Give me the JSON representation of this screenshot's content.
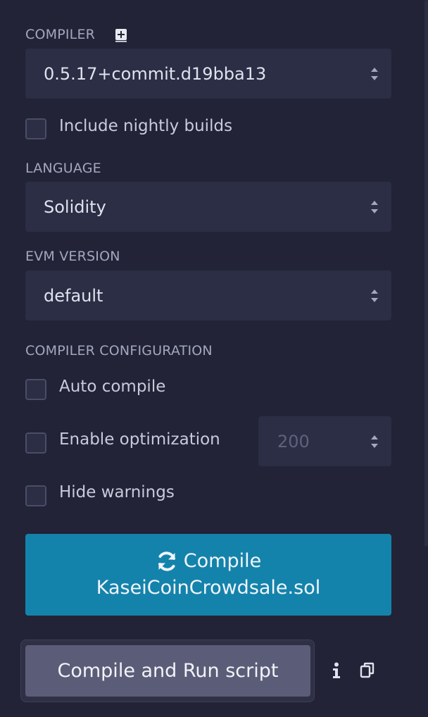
{
  "compiler": {
    "label": "COMPILER",
    "add_icon": "plus-square-icon",
    "version_value": "0.5.17+commit.d19bba13"
  },
  "nightly": {
    "label": "Include nightly builds",
    "checked": false
  },
  "language": {
    "label": "LANGUAGE",
    "value": "Solidity"
  },
  "evm": {
    "label": "EVM VERSION",
    "value": "default"
  },
  "config": {
    "label": "COMPILER CONFIGURATION",
    "auto_compile": {
      "label": "Auto compile",
      "checked": false
    },
    "optimization": {
      "label": "Enable optimization",
      "checked": false,
      "runs": "200"
    },
    "hide_warnings": {
      "label": "Hide warnings",
      "checked": false
    }
  },
  "compile_button": {
    "icon": "refresh-icon",
    "line1": "Compile",
    "line2": "KaseiCoinCrowdsale.sol"
  },
  "run_script_button": {
    "label": "Compile and Run script"
  },
  "icons": {
    "info": "info-icon",
    "copy": "copy-icon"
  },
  "colors": {
    "background": "#222336",
    "field": "#2b2e44",
    "primary": "#1483ab",
    "secondary": "#5b5d78"
  }
}
